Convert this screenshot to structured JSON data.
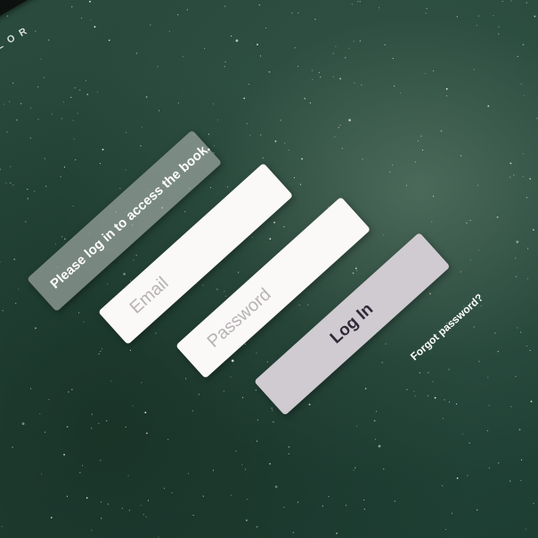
{
  "brand": {
    "text": "LOR"
  },
  "login_form": {
    "prompt": "Please log in to access the book.",
    "email_placeholder": "Email",
    "password_placeholder": "Password",
    "submit_label": "Log In",
    "forgot_label": "Forgot password?"
  },
  "colors": {
    "background": "#24473a",
    "prompt_card": "#afb4b0",
    "input_card": "#fbf8f8",
    "button_card": "#cfcbd1",
    "button_text": "#2e2a37"
  }
}
